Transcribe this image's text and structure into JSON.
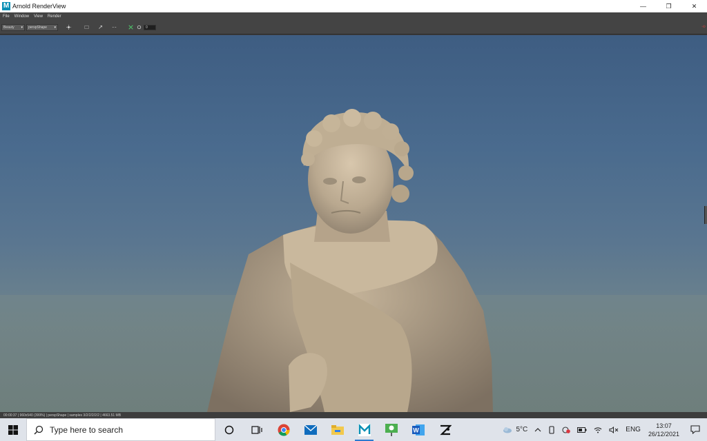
{
  "window": {
    "title": "Arnold RenderView",
    "logo_letter": "M",
    "minimize": "—",
    "restore": "❐",
    "close": "✕"
  },
  "menu": [
    "File",
    "Window",
    "View",
    "Render"
  ],
  "toolbar": {
    "aov": "Beauty",
    "camera": "perspShape",
    "dropdown_arrow": "▾",
    "frame_value": "0",
    "right_indicator": "◦⊙"
  },
  "viewport": {
    "subject": "marble statue render"
  },
  "status": {
    "text": "00:00:37 | 960x540 (399%) | perspShape | samples 3/2/2/2/2/2 | 4663.51 MB"
  },
  "taskbar": {
    "search_placeholder": "Type here to search",
    "apps": [
      "cortana",
      "task-view",
      "chrome",
      "mail",
      "file-explorer",
      "maya",
      "presentation",
      "word",
      "zbrush"
    ],
    "active_app": "maya",
    "weather": "5°C",
    "language": "ENG",
    "time": "13:07",
    "date": "26/12/2021"
  },
  "colors": {
    "maya_accent": "#0a8fb5",
    "taskbar_bg": "#dfe3ea",
    "ui_dark": "#444444"
  }
}
